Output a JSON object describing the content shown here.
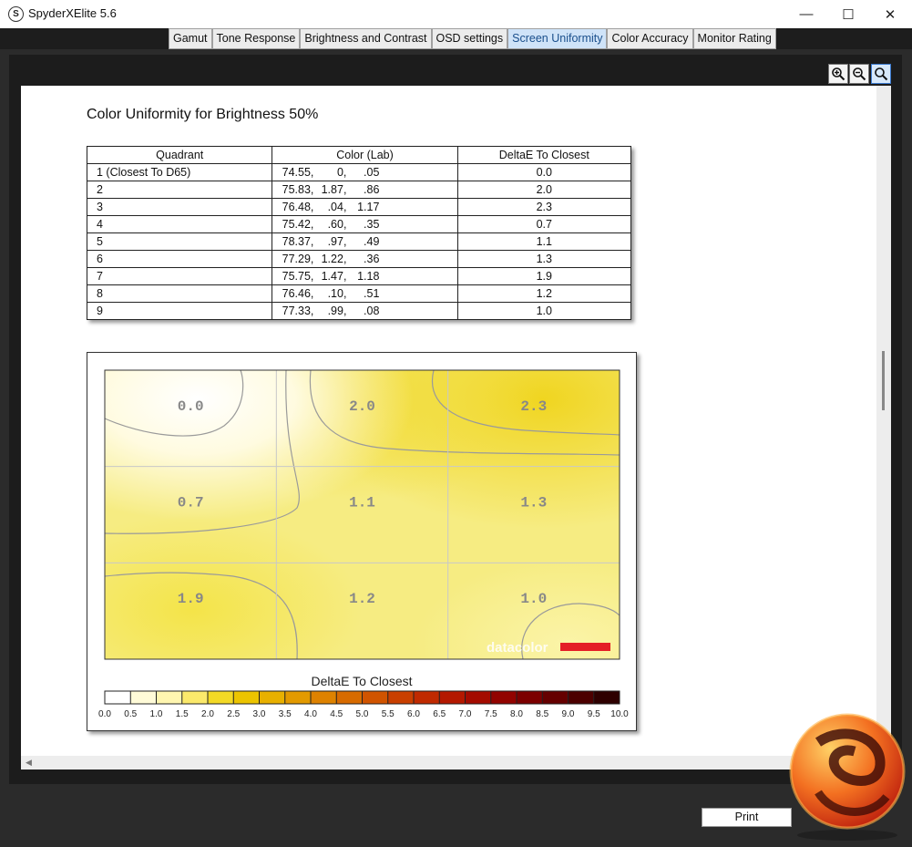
{
  "window": {
    "title": "SpyderXElite 5.6",
    "app_icon_letter": "S",
    "minimize": "—",
    "maximize": "☐",
    "close": "✕"
  },
  "tabs": [
    {
      "label": "Gamut",
      "active": false
    },
    {
      "label": "Tone Response",
      "active": false
    },
    {
      "label": "Brightness and Contrast",
      "active": false
    },
    {
      "label": "OSD settings",
      "active": false
    },
    {
      "label": "Screen Uniformity",
      "active": true
    },
    {
      "label": "Color Accuracy",
      "active": false
    },
    {
      "label": "Monitor Rating",
      "active": false
    }
  ],
  "toolbar": {
    "icons": [
      "zoom-in-icon",
      "zoom-out-icon",
      "zoom-fit-icon"
    ]
  },
  "report": {
    "title": "Color Uniformity for Brightness 50%",
    "table": {
      "headers": [
        "Quadrant",
        "Color (Lab)",
        "DeltaE To Closest"
      ],
      "rows": [
        {
          "quadrant": "1 (Closest To D65)",
          "lab": [
            "74.55,",
            "0,",
            ".05"
          ],
          "delta": "0.0"
        },
        {
          "quadrant": "2",
          "lab": [
            "75.83,",
            "1.87,",
            ".86"
          ],
          "delta": "2.0"
        },
        {
          "quadrant": "3",
          "lab": [
            "76.48,",
            ".04,",
            "1.17"
          ],
          "delta": "2.3"
        },
        {
          "quadrant": "4",
          "lab": [
            "75.42,",
            ".60,",
            ".35"
          ],
          "delta": "0.7"
        },
        {
          "quadrant": "5",
          "lab": [
            "78.37,",
            ".97,",
            ".49"
          ],
          "delta": "1.1"
        },
        {
          "quadrant": "6",
          "lab": [
            "77.29,",
            "1.22,",
            ".36"
          ],
          "delta": "1.3"
        },
        {
          "quadrant": "7",
          "lab": [
            "75.75,",
            "1.47,",
            "1.18"
          ],
          "delta": "1.9"
        },
        {
          "quadrant": "8",
          "lab": [
            "76.46,",
            ".10,",
            ".51"
          ],
          "delta": "1.2"
        },
        {
          "quadrant": "9",
          "lab": [
            "77.33,",
            ".99,",
            ".08"
          ],
          "delta": "1.0"
        }
      ]
    }
  },
  "chart_data": {
    "type": "heatmap",
    "title": "DeltaE To Closest",
    "grid": [
      [
        "0.0",
        "2.0",
        "2.3"
      ],
      [
        "0.7",
        "1.1",
        "1.3"
      ],
      [
        "1.9",
        "1.2",
        "1.0"
      ]
    ],
    "scale_ticks": [
      "0.0",
      "0.5",
      "1.0",
      "1.5",
      "2.0",
      "2.5",
      "3.0",
      "3.5",
      "4.0",
      "4.5",
      "5.0",
      "5.5",
      "6.0",
      "6.5",
      "7.0",
      "7.5",
      "8.0",
      "8.5",
      "9.0",
      "9.5",
      "10.0"
    ],
    "scale_colors": [
      "#ffffff",
      "#fffbd8",
      "#fff6b0",
      "#fbe96b",
      "#f3d925",
      "#ecc400",
      "#e8b000",
      "#e39a00",
      "#de8200",
      "#d86b00",
      "#d15400",
      "#c93f00",
      "#c02a00",
      "#b41800",
      "#a40b00",
      "#920300",
      "#7c0000",
      "#650000",
      "#4c0000",
      "#2e0000"
    ],
    "watermark": "datacolor",
    "watermark_accent": "#e41e26"
  },
  "footer": {
    "print_label": "Print"
  }
}
